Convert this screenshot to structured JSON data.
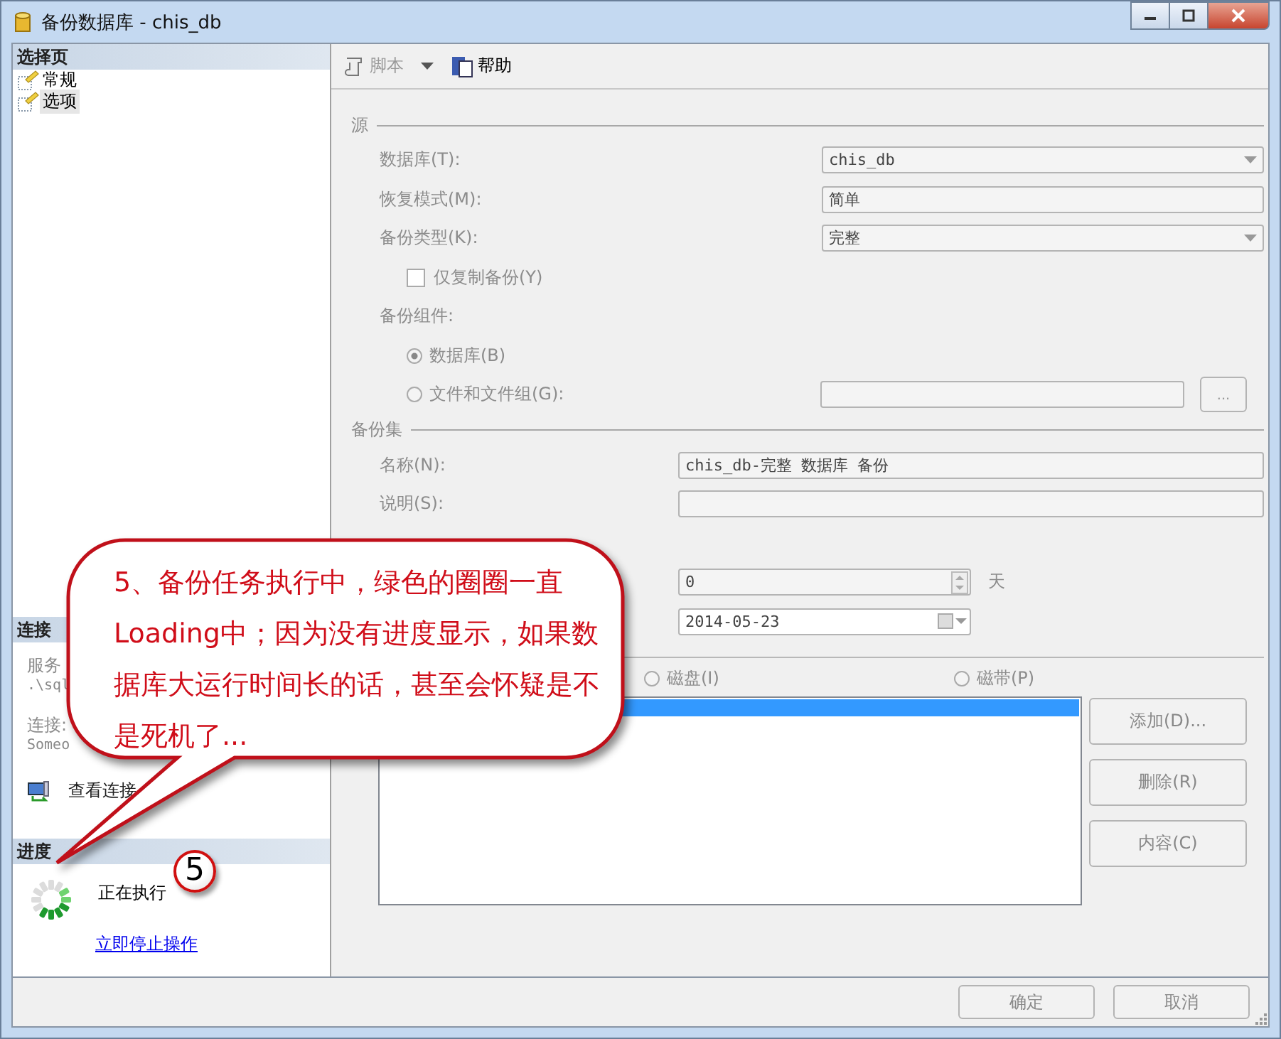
{
  "window": {
    "title": "备份数据库 - chis_db"
  },
  "sidebar": {
    "header": "选择页",
    "items": [
      {
        "label": "常规",
        "selected": false
      },
      {
        "label": "选项",
        "selected": true
      }
    ]
  },
  "connection": {
    "header": "连接",
    "server_label": "服务",
    "server_value": ".\\sql",
    "connection_label": "连接:",
    "connection_value": "Someo",
    "view_link": "查看连接"
  },
  "progress": {
    "header": "进度",
    "status": "正在执行",
    "stop_link": "立即停止操作"
  },
  "toolbar": [
    {
      "label": "脚本",
      "kind": "script",
      "disabled": true
    },
    {
      "label": "帮助",
      "kind": "help",
      "disabled": false
    }
  ],
  "source": {
    "heading": "源",
    "database_label": "数据库(T):",
    "database_value": "chis_db",
    "recovery_label": "恢复模式(M):",
    "recovery_value": "简单",
    "type_label": "备份类型(K):",
    "type_value": "完整",
    "copy_only": {
      "label": "仅复制备份(Y)",
      "checked": false
    },
    "component_label": "备份组件:",
    "components": [
      {
        "label": "数据库(B)",
        "selected": true
      },
      {
        "label": "文件和文件组(G):",
        "selected": false
      }
    ],
    "browse_button": "..."
  },
  "backup_set": {
    "heading": "备份集",
    "name_label": "名称(N):",
    "name_value": "chis_db-完整 数据库 备份",
    "description_label": "说明(S):",
    "days_value": "0",
    "days_unit": "天",
    "date_value": "2014-05-23"
  },
  "destination": {
    "media": [
      {
        "label": "磁盘(I)",
        "selected": false
      },
      {
        "label": "磁带(P)",
        "selected": false
      }
    ],
    "rows": [
      {
        "selected": true
      }
    ],
    "buttons": [
      "添加(D)...",
      "删除(R)",
      "内容(C)"
    ]
  },
  "footer": {
    "buttons": [
      "确定",
      "取消"
    ]
  },
  "annotation": {
    "text": "5、备份任务执行中，绿色的圈圈一直Loading中；因为没有进度显示，如果数据库大运行时间长的话，甚至会怀疑是不是死机了...",
    "badge": "5"
  }
}
